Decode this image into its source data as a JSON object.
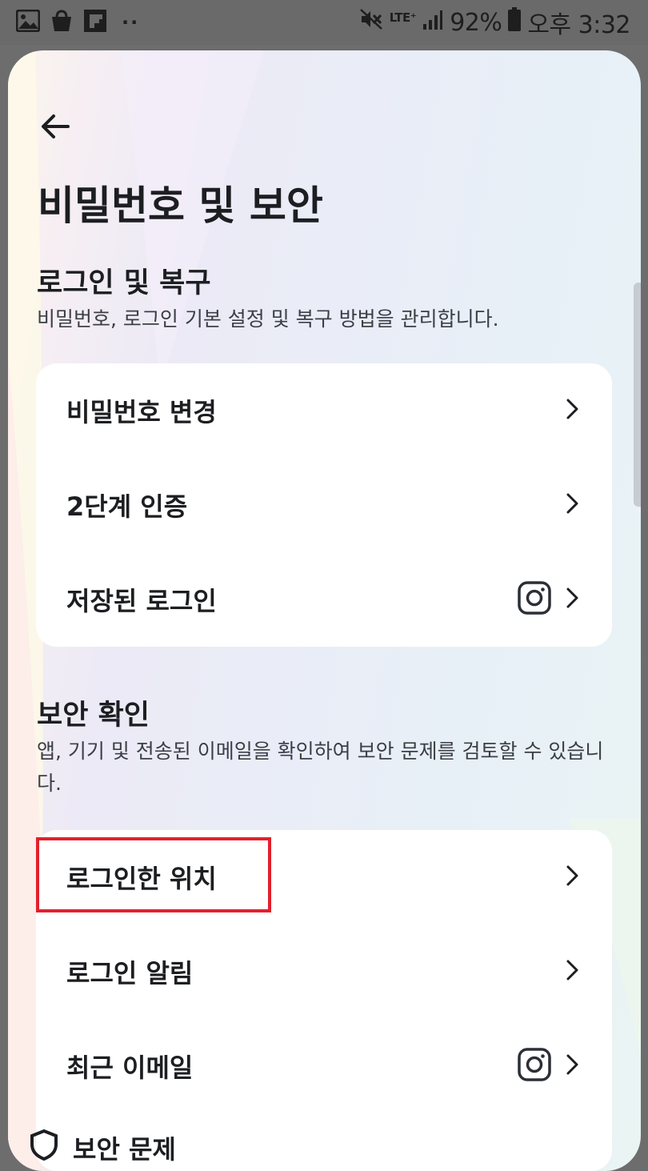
{
  "status_bar": {
    "left_icons": [
      "gallery-icon",
      "shopping-bag-icon",
      "flipboard-icon"
    ],
    "dots": "··",
    "network": "LTE⁺",
    "battery_percent": "92%",
    "time": "오후 3:32"
  },
  "header": {
    "back_icon": "arrow-left-icon",
    "title": "비밀번호 및 보안"
  },
  "sections": [
    {
      "title": "로그인 및 복구",
      "description": "비밀번호, 로그인 기본 설정 및 복구 방법을 관리합니다.",
      "items": [
        {
          "label": "비밀번호 변경",
          "app_icon": null
        },
        {
          "label": "2단계 인증",
          "app_icon": null
        },
        {
          "label": "저장된 로그인",
          "app_icon": "instagram-icon"
        }
      ]
    },
    {
      "title": "보안 확인",
      "description": "앱, 기기 및 전송된 이메일을 확인하여 보안 문제를 검토할 수 있습니다.",
      "items": [
        {
          "label": "로그인한 위치",
          "app_icon": null,
          "highlighted": true
        },
        {
          "label": "로그인 알림",
          "app_icon": null
        },
        {
          "label": "최근 이메일",
          "app_icon": "instagram-icon"
        }
      ]
    }
  ],
  "peek_item": {
    "label": "보안 문제",
    "icon": "shield-icon"
  },
  "colors": {
    "highlight": "#e2202c",
    "card": "#ffffff",
    "text": "#1c1e21"
  }
}
